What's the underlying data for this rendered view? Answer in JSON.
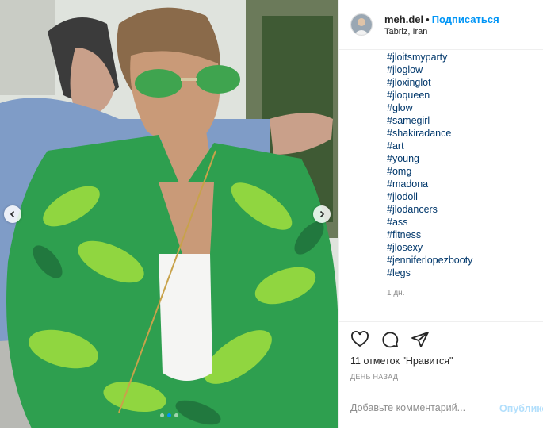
{
  "post": {
    "username": "meh.del",
    "separator": "•",
    "follow_label": "Подписаться",
    "location": "Tabriz, Iran",
    "hashtags": [
      "#jloitsmyparty",
      "#jloglow",
      "#jloxinglot",
      "#jloqueen",
      "#glow",
      "#samegirl",
      "#shakiradance",
      "#art",
      "#young",
      "#omg",
      "#madona",
      "#jlodoll",
      "#jlodancers",
      "#ass",
      "#fitness",
      "#jlosexy",
      "#jenniferlopezbooty",
      "#legs"
    ],
    "caption_time": "1 дн.",
    "likes_text": "11 отметок \"Нравится\"",
    "date_text": "ДЕНЬ НАЗАД",
    "comment_placeholder": "Добавьте комментарий...",
    "publish_label": "Опубликовать"
  },
  "carousel": {
    "slide_count": 3,
    "active_index": 1
  },
  "icons": {
    "like": "heart-icon",
    "comment": "comment-icon",
    "share": "share-icon",
    "prev": "chevron-left-icon",
    "next": "chevron-right-icon"
  },
  "colors": {
    "accent": "#0095f6",
    "publish_disabled": "#b2dffc",
    "hashtag": "#00376b",
    "muted": "#8e8e8e"
  }
}
